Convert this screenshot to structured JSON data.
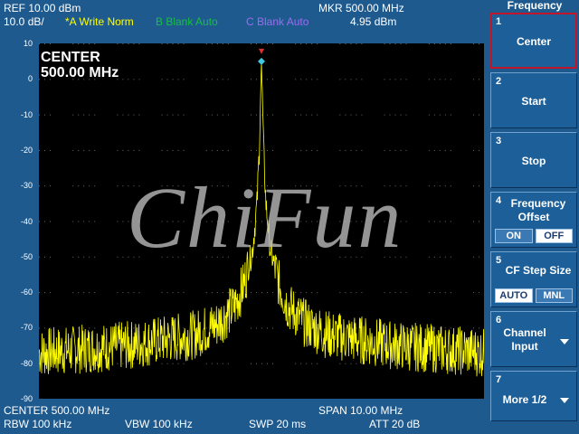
{
  "header": {
    "ref": "REF  10.00 dBm",
    "scale": "10.0 dB/",
    "trace_a": "*A Write Norm",
    "trace_b": "B Blank Auto",
    "trace_c": "C Blank Auto",
    "marker_freq": "MKR 500.00 MHz",
    "marker_level": "4.95 dBm"
  },
  "display": {
    "center_title": "CENTER",
    "center_value": "500.00 MHz",
    "watermark": "ChiFun",
    "y_ticks": [
      "10",
      "0",
      "-10",
      "-20",
      "-30",
      "-40",
      "-50",
      "-60",
      "-70",
      "-80",
      "-90"
    ]
  },
  "footer": {
    "center": "CENTER 500.00 MHz",
    "span": "SPAN 10.00 MHz",
    "rbw": "RBW 100 kHz",
    "vbw": "VBW  100 kHz",
    "swp": "SWP  20 ms",
    "att": "ATT 20 dB"
  },
  "softkeys": {
    "title": "Frequency",
    "k1": {
      "num": "1",
      "label": "Center"
    },
    "k2": {
      "num": "2",
      "label": "Start"
    },
    "k3": {
      "num": "3",
      "label": "Stop"
    },
    "k4": {
      "num": "4",
      "label": "Frequency",
      "label2": "Offset",
      "on": "ON",
      "off": "OFF"
    },
    "k5": {
      "num": "5",
      "label": "CF Step Size",
      "auto": "AUTO",
      "mnl": "MNL"
    },
    "k6": {
      "num": "6",
      "label": "Channel",
      "label2": "Input"
    },
    "k7": {
      "num": "7",
      "label": "More 1/2"
    }
  },
  "colors": {
    "background": "#1f5a8e",
    "trace": "#ffff00",
    "marker": "#40c8e0",
    "marker_top": "#e03030"
  },
  "chart_data": {
    "type": "line",
    "xlabel": "",
    "ylabel": "",
    "x_unit": "MHz",
    "y_unit": "dBm",
    "xlim": [
      495.0,
      505.0
    ],
    "ylim": [
      -90,
      10
    ],
    "grid": true,
    "series": [
      {
        "x": [
          495.0,
          496.0,
          497.0,
          498.0,
          498.5,
          499.0,
          499.4,
          499.6,
          499.8,
          499.9,
          499.95,
          500.0,
          500.05,
          500.1,
          500.2,
          500.4,
          500.6,
          501.0,
          501.5,
          502.0,
          503.0,
          504.0,
          505.0
        ],
        "values": [
          -77,
          -76,
          -75,
          -73,
          -72,
          -69,
          -64,
          -58,
          -48,
          -35,
          -20,
          4.95,
          -20,
          -35,
          -48,
          -58,
          -64,
          -69,
          -72,
          -73,
          -75,
          -76,
          -77
        ]
      }
    ],
    "marker": {
      "x": 500.0,
      "y": 4.95
    }
  }
}
